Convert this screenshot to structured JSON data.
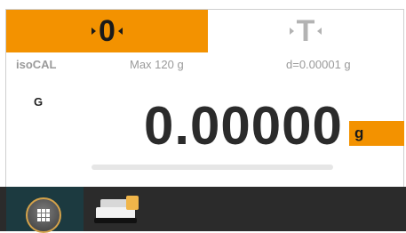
{
  "keys": {
    "zero_label": "0",
    "tare_label": "T"
  },
  "info": {
    "calibration": "isoCAL",
    "max_capacity": "Max 120 g",
    "readability": "d=0.00001 g"
  },
  "reading": {
    "mode": "G",
    "value": "0.00000",
    "unit": "g"
  },
  "capacity_bar": {
    "fill_fraction": 0.0
  },
  "colors": {
    "accent": "#f39200",
    "taskbar": "#2b2b2b",
    "apps_button": "#1c3a40"
  },
  "taskbar": {
    "items": [
      {
        "icon": "apps-grid-icon"
      },
      {
        "icon": "weighing-app-icon"
      }
    ]
  }
}
